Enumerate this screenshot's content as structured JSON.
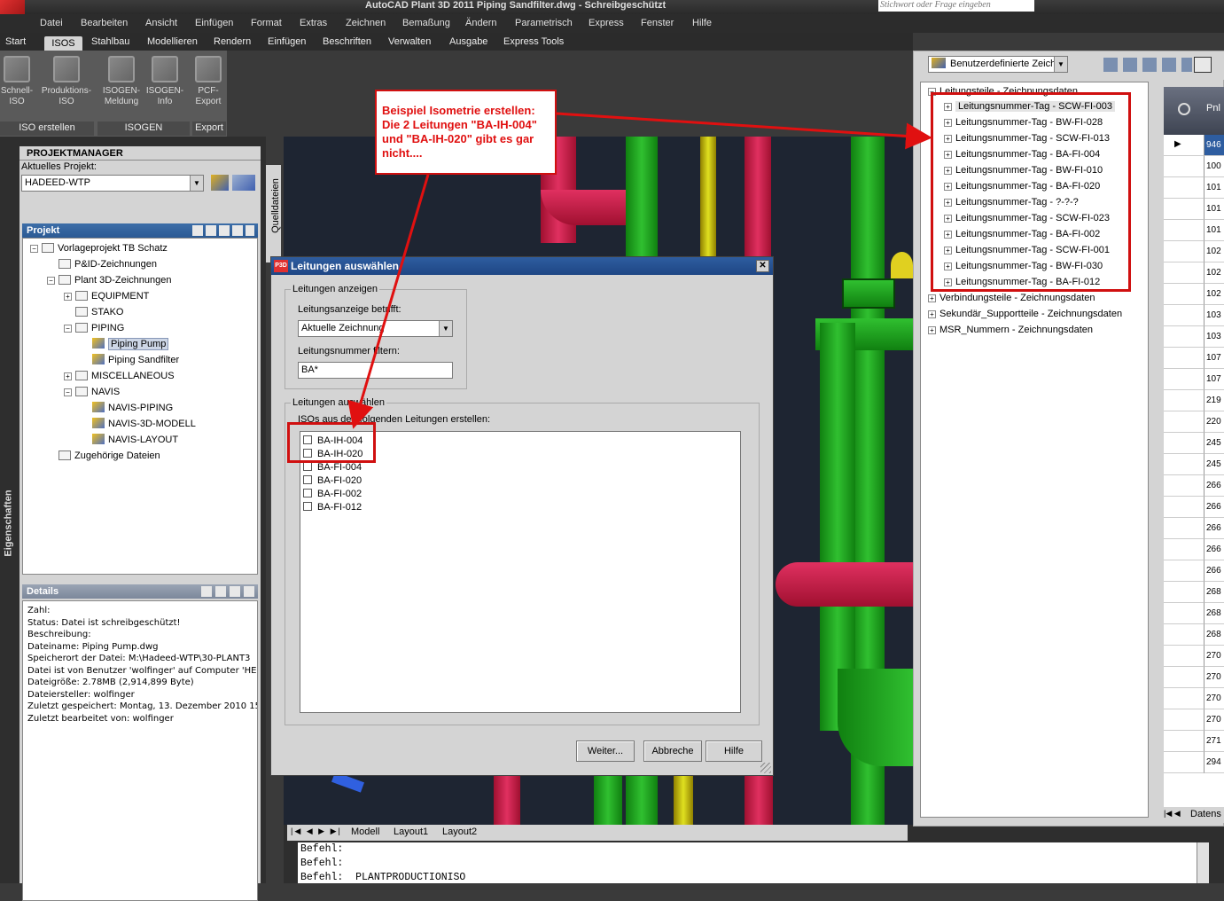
{
  "window": {
    "title": "AutoCAD Plant 3D 2011   Piping Sandfilter.dwg - Schreibgeschützt",
    "search_placeholder": "Stichwort oder Frage eingeben"
  },
  "menu": [
    "Datei",
    "Bearbeiten",
    "Ansicht",
    "Einfügen",
    "Format",
    "Extras",
    "Zeichnen",
    "Bemaßung",
    "Ändern",
    "Parametrisch",
    "Express",
    "Fenster",
    "Hilfe"
  ],
  "ribbon_tabs": [
    "Start",
    "ISOS",
    "Stahlbau",
    "Modellieren",
    "Rendern",
    "Einfügen",
    "Beschriften",
    "Verwalten",
    "Ausgabe",
    "Express Tools"
  ],
  "ribbon": {
    "buttons": [
      {
        "label1": "Schnell-",
        "label2": "ISO",
        "icon": "quick-iso-icon"
      },
      {
        "label1": "Produktions-",
        "label2": "ISO",
        "icon": "production-iso-icon"
      },
      {
        "label1": "ISOGEN-",
        "label2": "Meldung",
        "icon": "isogen-message-icon"
      },
      {
        "label1": "ISOGEN-",
        "label2": "Info",
        "icon": "isogen-info-icon"
      },
      {
        "label1": "PCF-",
        "label2": "Export",
        "icon": "pcf-export-icon"
      }
    ],
    "groups": [
      "ISO erstellen",
      "ISOGEN",
      "Export"
    ]
  },
  "projektmanager": {
    "title": "PROJEKTMANAGER",
    "current_project_label": "Aktuelles Projekt:",
    "current_project": "HADEED-WTP",
    "projekt_header": "Projekt",
    "side_tab": "Quelldateien",
    "side_strip": "Eigenschaften",
    "tree": [
      {
        "label": "Vorlageprojekt TB Schatz",
        "level": 0,
        "exp": "-",
        "icon": "project"
      },
      {
        "label": "P&ID-Zeichnungen",
        "level": 1,
        "exp": "",
        "icon": "folder"
      },
      {
        "label": "Plant 3D-Zeichnungen",
        "level": 1,
        "exp": "-",
        "icon": "folder"
      },
      {
        "label": "EQUIPMENT",
        "level": 2,
        "exp": "+",
        "icon": "folder"
      },
      {
        "label": "STAKO",
        "level": 2,
        "exp": "",
        "icon": "folder"
      },
      {
        "label": "PIPING",
        "level": 2,
        "exp": "-",
        "icon": "folder"
      },
      {
        "label": "Piping Pump",
        "level": 3,
        "exp": "",
        "icon": "drawing",
        "selected": true
      },
      {
        "label": "Piping Sandfilter",
        "level": 3,
        "exp": "",
        "icon": "drawing"
      },
      {
        "label": "MISCELLANEOUS",
        "level": 2,
        "exp": "+",
        "icon": "folder"
      },
      {
        "label": "NAVIS",
        "level": 2,
        "exp": "-",
        "icon": "folder"
      },
      {
        "label": "NAVIS-PIPING",
        "level": 3,
        "exp": "",
        "icon": "drawing"
      },
      {
        "label": "NAVIS-3D-MODELL",
        "level": 3,
        "exp": "",
        "icon": "drawing"
      },
      {
        "label": "NAVIS-LAYOUT",
        "level": 3,
        "exp": "",
        "icon": "drawing"
      },
      {
        "label": "Zugehörige Dateien",
        "level": 1,
        "exp": "",
        "icon": "folder"
      }
    ],
    "details_header": "Details",
    "details": [
      "Zahl:",
      "Status:  Datei ist schreibgeschützt!",
      "Beschreibung:",
      "Dateiname:  Piping Pump.dwg",
      "Speicherort der Datei: M:\\Hadeed-WTP\\30-PLANT3",
      "Datei ist von Benutzer 'wolfinger' auf Computer 'HE",
      "Dateigröße:  2.78MB (2,914,899 Byte)",
      "Dateiersteller:  wolfinger",
      "Zuletzt gespeichert: Montag, 13. Dezember 2010 15",
      "Zuletzt bearbeitet von: wolfinger"
    ]
  },
  "dialog": {
    "title": "Leitungen auswählen",
    "group1": "Leitungen anzeigen",
    "display_label": "Leitungsanzeige betrifft:",
    "display_value": "Aktuelle Zeichnung",
    "filter_label": "Leitungsnummer filtern:",
    "filter_value": "BA*",
    "group2": "Leitungen auswählen",
    "list_label": "ISOs aus den folgenden Leitungen erstellen:",
    "lines": [
      "BA-IH-004",
      "BA-IH-020",
      "BA-FI-004",
      "BA-FI-020",
      "BA-FI-002",
      "BA-FI-012"
    ],
    "buttons": {
      "next": "Weiter...",
      "cancel": "Abbreche",
      "help": "Hilfe"
    }
  },
  "annotation": {
    "line1": "Beispiel Isometrie erstellen:",
    "line2": "Die 2 Leitungen \"BA-IH-004\"",
    "line3": "und \"BA-IH-020\" gibt es gar",
    "line4": "nicht...."
  },
  "right_panel": {
    "dropdown": "Benutzerdefinierte Zeich",
    "tree_root": "Leitungsteile - Zeichnungsdaten",
    "tags": [
      "Leitungsnummer-Tag - SCW-FI-003",
      "Leitungsnummer-Tag - BW-FI-028",
      "Leitungsnummer-Tag - SCW-FI-013",
      "Leitungsnummer-Tag - BA-FI-004",
      "Leitungsnummer-Tag - BW-FI-010",
      "Leitungsnummer-Tag - BA-FI-020",
      "Leitungsnummer-Tag - ?-?-?",
      "Leitungsnummer-Tag - SCW-FI-023",
      "Leitungsnummer-Tag - BA-FI-002",
      "Leitungsnummer-Tag - SCW-FI-001",
      "Leitungsnummer-Tag - BW-FI-030",
      "Leitungsnummer-Tag - BA-FI-012"
    ],
    "other_nodes": [
      "Verbindungsteile - Zeichnungsdaten",
      "Sekundär_Supportteile - Zeichnungsdaten",
      "MSR_Nummern - Zeichnungsdaten"
    ],
    "grid_header": "Pnl",
    "grid_values": [
      "946",
      "100",
      "101",
      "101",
      "101",
      "102",
      "102",
      "102",
      "103",
      "103",
      "107",
      "107",
      "219",
      "220",
      "245",
      "245",
      "266",
      "266",
      "266",
      "266",
      "266",
      "268",
      "268",
      "268",
      "270",
      "270",
      "270",
      "270",
      "271",
      "294"
    ],
    "grid_tab": "Datens"
  },
  "command": {
    "layout_tabs": [
      "Modell",
      "Layout1",
      "Layout2"
    ],
    "lines": [
      "Befehl:",
      "Befehl:",
      "Befehl:  PLANTPRODUCTIONISO"
    ]
  }
}
